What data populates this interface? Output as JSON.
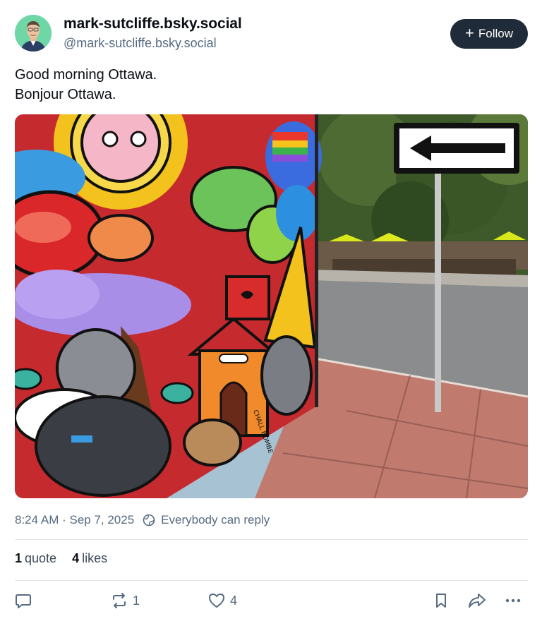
{
  "author": {
    "display_name": "mark-sutcliffe.bsky.social",
    "handle": "@mark-sutcliffe.bsky.social",
    "avatar_bg": "#6fd6a6"
  },
  "follow_button": {
    "icon": "plus-icon",
    "label": "Follow"
  },
  "post": {
    "lines": [
      "Good morning Ottawa.",
      "Bonjour Ottawa."
    ],
    "image_signature": "CHALL BOMBE"
  },
  "meta": {
    "timestamp": "8:24 AM · Sep 7, 2025",
    "reply_icon": "globe-icon",
    "reply_setting": "Everybody can reply"
  },
  "stats": {
    "quotes_count": "1",
    "quotes_label": "quote",
    "likes_count": "4",
    "likes_label": "likes"
  },
  "actions": {
    "reply": {
      "icon": "reply-icon",
      "count": ""
    },
    "repost": {
      "icon": "repost-icon",
      "count": "1"
    },
    "like": {
      "icon": "heart-icon",
      "count": "4"
    },
    "bookmark": {
      "icon": "bookmark-icon"
    },
    "share": {
      "icon": "share-icon"
    },
    "more": {
      "icon": "more-icon"
    }
  },
  "colors": {
    "follow_bg": "#1f2b38",
    "muted_text": "#566b80",
    "divider": "#dfe4ea"
  }
}
